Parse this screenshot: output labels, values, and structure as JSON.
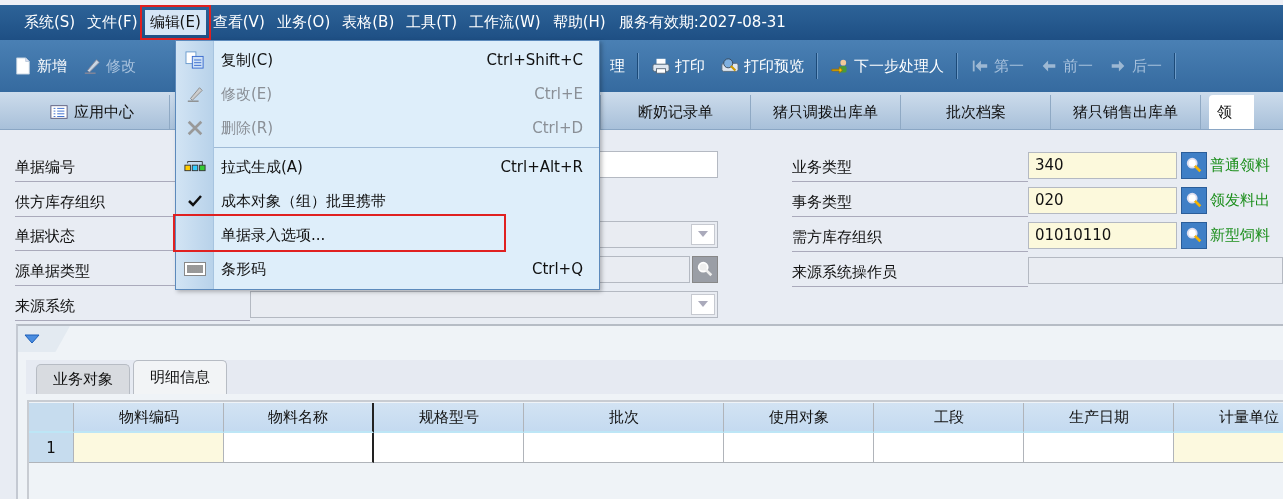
{
  "menubar": [
    {
      "label": "系统(S)",
      "selected": false,
      "annotated": false
    },
    {
      "label": "文件(F)",
      "selected": false,
      "annotated": false
    },
    {
      "label": "编辑(E)",
      "selected": true,
      "annotated": true
    },
    {
      "label": "查看(V)",
      "selected": false,
      "annotated": false
    },
    {
      "label": "业务(O)",
      "selected": false,
      "annotated": false
    },
    {
      "label": "表格(B)",
      "selected": false,
      "annotated": false
    },
    {
      "label": "工具(T)",
      "selected": false,
      "annotated": false
    },
    {
      "label": "工作流(W)",
      "selected": false,
      "annotated": false
    },
    {
      "label": "帮助(H)",
      "selected": false,
      "annotated": false
    }
  ],
  "service_expiry": "服务有效期:2027-08-31",
  "toolbar": [
    {
      "kind": "new",
      "label": "新增",
      "disabled": false
    },
    {
      "kind": "edit",
      "label": "修改",
      "disabled": true
    },
    {
      "kind": "text",
      "label": "理",
      "disabled": false
    },
    {
      "kind": "separator"
    },
    {
      "kind": "print",
      "label": "打印",
      "disabled": false
    },
    {
      "kind": "preview",
      "label": "打印预览",
      "disabled": false
    },
    {
      "kind": "separator"
    },
    {
      "kind": "assign",
      "label": "下一步处理人",
      "disabled": false
    },
    {
      "kind": "separator"
    },
    {
      "kind": "first",
      "label": "第一",
      "disabled": true
    },
    {
      "kind": "prev",
      "label": "前一",
      "disabled": true
    },
    {
      "kind": "next",
      "label": "后一",
      "disabled": true
    },
    {
      "kind": "separator"
    }
  ],
  "tabs": [
    {
      "kind": "home",
      "label": "应用中心",
      "selected": false
    },
    {
      "kind": "plain",
      "label": "断奶记录单",
      "selected": false
    },
    {
      "kind": "plain",
      "label": "猪只调拨出库单",
      "selected": false
    },
    {
      "kind": "plain",
      "label": "批次档案",
      "selected": false
    },
    {
      "kind": "plain",
      "label": "猪只销售出库单",
      "selected": false
    },
    {
      "kind": "plain",
      "label": "领",
      "selected": true
    }
  ],
  "edit_menu": [
    {
      "kind": "copy",
      "label": "复制(C)",
      "shortcut": "Ctrl+Shift+C",
      "disabled": false,
      "annotated": false
    },
    {
      "kind": "edit",
      "label": "修改(E)",
      "shortcut": "Ctrl+E",
      "disabled": true,
      "annotated": false
    },
    {
      "kind": "delete",
      "label": "删除(R)",
      "shortcut": "Ctrl+D",
      "disabled": true,
      "annotated": false
    },
    {
      "kind": "separator"
    },
    {
      "kind": "pull",
      "label": "拉式生成(A)",
      "shortcut": "Ctrl+Alt+R",
      "disabled": false,
      "annotated": false
    },
    {
      "kind": "check",
      "label": "成本对象（组）批里携带",
      "checked": true,
      "disabled": false,
      "annotated": false
    },
    {
      "kind": "plain",
      "label": "单据录入选项...",
      "disabled": false,
      "annotated": true
    },
    {
      "kind": "barcode",
      "label": "条形码",
      "shortcut": "Ctrl+Q",
      "disabled": false,
      "annotated": false
    }
  ],
  "form_left": [
    {
      "kind": "text",
      "label": "单据编号"
    },
    {
      "kind": "label_only",
      "label": "供方库存组织"
    },
    {
      "kind": "select",
      "label": "单据状态"
    },
    {
      "kind": "lookup",
      "label": "源单据类型"
    },
    {
      "kind": "select",
      "label": "来源系统"
    }
  ],
  "form_right": [
    {
      "kind": "lookup",
      "label": "业务类型",
      "value": "340",
      "note": "普通领料",
      "required": true
    },
    {
      "kind": "lookup",
      "label": "事务类型",
      "value": "020",
      "note": "领发料出",
      "required": true
    },
    {
      "kind": "lookup",
      "label": "需方库存组织",
      "value": "01010110",
      "note": "新型饲料",
      "required": true
    },
    {
      "kind": "readonly",
      "label": "来源系统操作员",
      "required": false
    }
  ],
  "detail": {
    "tabs": [
      {
        "label": "业务对象",
        "selected": false
      },
      {
        "label": "明细信息",
        "selected": true
      }
    ],
    "columns": [
      {
        "label": "物料编码",
        "required": true
      },
      {
        "label": "物料名称",
        "required": false
      },
      {
        "label": "规格型号",
        "required": false
      },
      {
        "label": "批次",
        "required": false
      },
      {
        "label": "使用对象",
        "required": false
      },
      {
        "label": "工段",
        "required": false
      },
      {
        "label": "生产日期",
        "required": false
      },
      {
        "label": "计量单位",
        "required": true
      }
    ],
    "rows": [
      {
        "number": "1"
      }
    ]
  }
}
